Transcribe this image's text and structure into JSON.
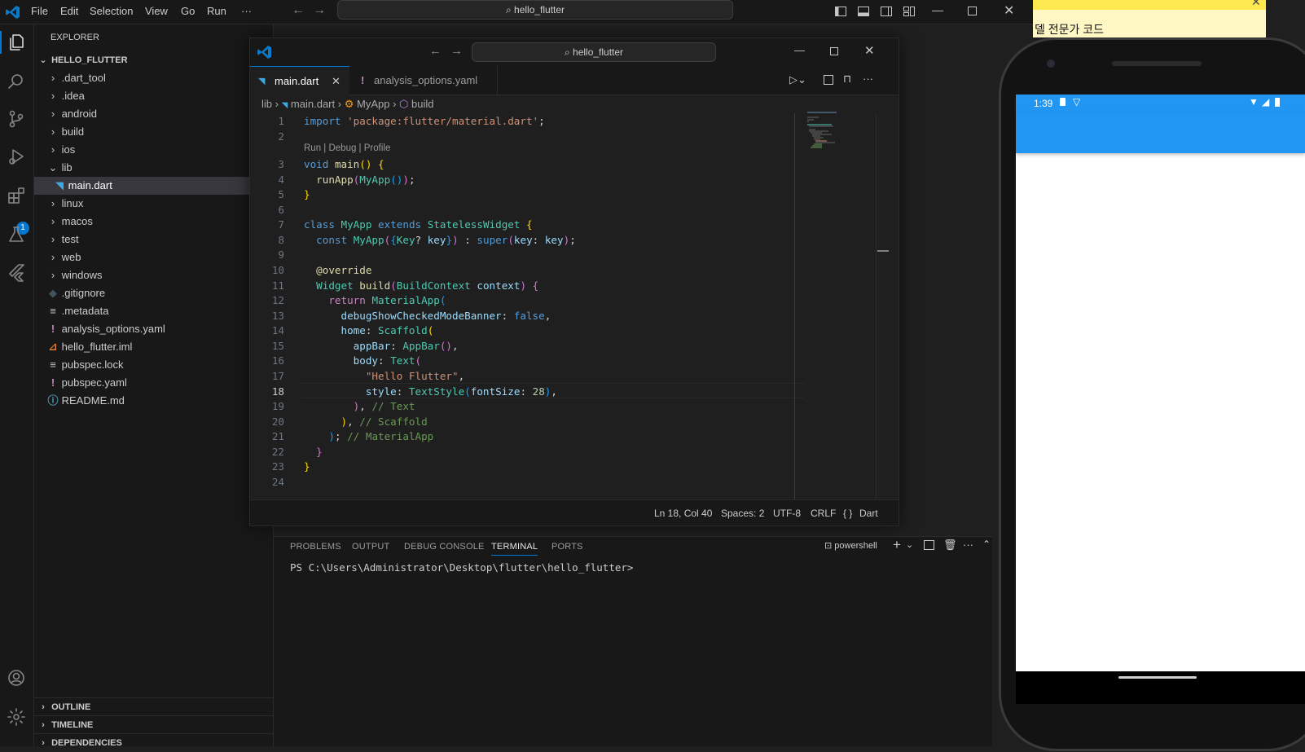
{
  "titlebar": {
    "menus": [
      "File",
      "Edit",
      "Selection",
      "View",
      "Go",
      "Run",
      "···"
    ],
    "search": "hello_flutter"
  },
  "activity_bar": {
    "icons": [
      "files-icon",
      "search-icon",
      "source-control-icon",
      "run-debug-icon",
      "extensions-icon",
      "testing-icon",
      "flutter-icon",
      "account-icon",
      "settings-gear-icon"
    ],
    "extensions_badge": "1"
  },
  "sidebar": {
    "title": "EXPLORER",
    "project": "HELLO_FLUTTER",
    "items": [
      {
        "label": ".dart_tool",
        "type": "folder"
      },
      {
        "label": ".idea",
        "type": "folder"
      },
      {
        "label": "android",
        "type": "folder"
      },
      {
        "label": "build",
        "type": "folder"
      },
      {
        "label": "ios",
        "type": "folder"
      },
      {
        "label": "lib",
        "type": "folder-open"
      },
      {
        "label": "main.dart",
        "type": "dart"
      },
      {
        "label": "linux",
        "type": "folder"
      },
      {
        "label": "macos",
        "type": "folder"
      },
      {
        "label": "test",
        "type": "folder"
      },
      {
        "label": "web",
        "type": "folder"
      },
      {
        "label": "windows",
        "type": "folder"
      },
      {
        "label": ".gitignore",
        "type": "git"
      },
      {
        "label": ".metadata",
        "type": "lines"
      },
      {
        "label": "analysis_options.yaml",
        "type": "yaml"
      },
      {
        "label": "hello_flutter.iml",
        "type": "rss"
      },
      {
        "label": "pubspec.lock",
        "type": "lines"
      },
      {
        "label": "pubspec.yaml",
        "type": "yaml"
      },
      {
        "label": "README.md",
        "type": "info"
      }
    ],
    "sections": [
      "OUTLINE",
      "TIMELINE",
      "DEPENDENCIES"
    ]
  },
  "editor": {
    "search": "hello_flutter",
    "tabs": [
      {
        "label": "main.dart",
        "close": "✕"
      },
      {
        "label": "analysis_options.yaml"
      }
    ],
    "breadcrumb": {
      "folder": "lib",
      "file": "main.dart",
      "class": "MyApp",
      "method": "build"
    },
    "codelens": "Run | Debug | Profile",
    "line_numbers": [
      "1",
      "2",
      "3",
      "4",
      "5",
      "6",
      "7",
      "8",
      "9",
      "10",
      "11",
      "12",
      "13",
      "14",
      "15",
      "16",
      "17",
      "18",
      "19",
      "20",
      "21",
      "22",
      "23",
      "24"
    ],
    "current_line": "18"
  },
  "status": {
    "position": "Ln 18, Col 40",
    "spaces": "Spaces: 2",
    "encoding": "UTF-8",
    "eol": "CRLF",
    "language": "Dart",
    "language_glyph": "{ }"
  },
  "panel": {
    "tabs": [
      "PROBLEMS",
      "OUTPUT",
      "DEBUG CONSOLE",
      "TERMINAL",
      "PORTS"
    ],
    "active_tab": "TERMINAL",
    "shell": "powershell",
    "prompt": "PS C:\\Users\\Administrator\\Desktop\\flutter\\hello_flutter>"
  },
  "sticky_note": {
    "text": "델 전문가 코드"
  },
  "phone": {
    "time": "1:39"
  },
  "colors": {
    "accent": "#0078d4",
    "flutter_blue": "#2196f3",
    "sticky": "#fff7c4"
  }
}
